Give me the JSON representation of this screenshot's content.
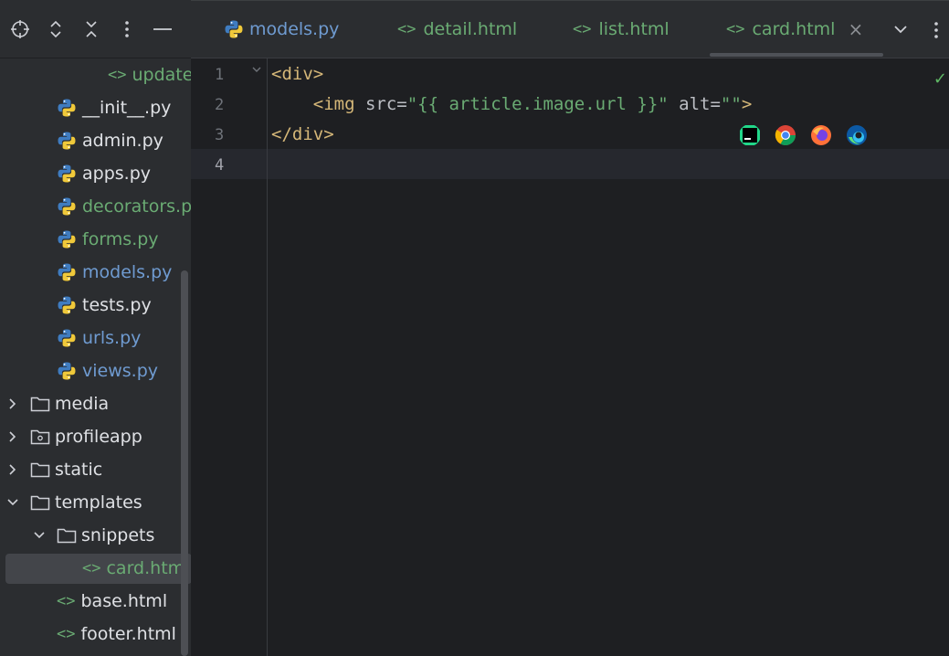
{
  "sidebar": {
    "toolbar": [
      {
        "name": "locate-icon"
      },
      {
        "name": "expand-all-icon"
      },
      {
        "name": "collapse-all-icon"
      },
      {
        "name": "more-options-icon"
      },
      {
        "name": "hide-icon"
      }
    ],
    "tree": [
      {
        "label": "update",
        "icon": "html",
        "color": "green"
      },
      {
        "label": "__init__.py",
        "icon": "python",
        "color": "default"
      },
      {
        "label": "admin.py",
        "icon": "python",
        "color": "default"
      },
      {
        "label": "apps.py",
        "icon": "python",
        "color": "default"
      },
      {
        "label": "decorators.py",
        "icon": "python",
        "color": "green"
      },
      {
        "label": "forms.py",
        "icon": "python",
        "color": "green"
      },
      {
        "label": "models.py",
        "icon": "python",
        "color": "blue"
      },
      {
        "label": "tests.py",
        "icon": "python",
        "color": "default"
      },
      {
        "label": "urls.py",
        "icon": "python",
        "color": "blue"
      },
      {
        "label": "views.py",
        "icon": "python",
        "color": "blue"
      },
      {
        "label": "media",
        "icon": "folder",
        "color": "default",
        "arrow": "collapsed"
      },
      {
        "label": "profileapp",
        "icon": "module-folder",
        "color": "default",
        "arrow": "collapsed"
      },
      {
        "label": "static",
        "icon": "folder",
        "color": "default",
        "arrow": "collapsed"
      },
      {
        "label": "templates",
        "icon": "folder",
        "color": "default",
        "arrow": "expanded"
      },
      {
        "label": "snippets",
        "icon": "folder",
        "color": "default",
        "arrow": "expanded"
      },
      {
        "label": "card.html",
        "icon": "html",
        "color": "green",
        "selected": true
      },
      {
        "label": "base.html",
        "icon": "html",
        "color": "default"
      },
      {
        "label": "footer.html",
        "icon": "html",
        "color": "default"
      }
    ]
  },
  "tabs": [
    {
      "label": "models.py",
      "icon": "python",
      "color": "#6f9bd1"
    },
    {
      "label": "detail.html",
      "icon": "<>",
      "color": "#6aab73"
    },
    {
      "label": "list.html",
      "icon": "<>",
      "color": "#6aab73"
    },
    {
      "label": "card.html",
      "icon": "<>",
      "color": "#6aab73",
      "active": true
    }
  ],
  "tab_controls": {
    "close": "×",
    "dropdown": "chevron-down-icon",
    "more": "more-options-icon"
  },
  "editor": {
    "lines": [
      {
        "num": "1",
        "parts": [
          {
            "t": "<div>",
            "c": "tag"
          }
        ]
      },
      {
        "num": "2",
        "parts": [
          {
            "t": "    ",
            "c": "attr"
          },
          {
            "t": "<img ",
            "c": "tag"
          },
          {
            "t": "src=",
            "c": "attr"
          },
          {
            "t": "\"{{ article.image.url }}\"",
            "c": "str"
          },
          {
            "t": " alt=",
            "c": "attr"
          },
          {
            "t": "\"\"",
            "c": "str"
          },
          {
            "t": ">",
            "c": "tag"
          }
        ]
      },
      {
        "num": "3",
        "parts": [
          {
            "t": "</div>",
            "c": "tag"
          }
        ]
      },
      {
        "num": "4",
        "parts": []
      }
    ],
    "current_line": "4",
    "status_icon": "✓",
    "browsers": [
      "pycharm-preview-icon",
      "chrome-icon",
      "firefox-icon",
      "edge-icon"
    ]
  },
  "colors": {
    "green": "#6aab73",
    "blue": "#6f9bd1",
    "default": "#dfe1e5"
  }
}
